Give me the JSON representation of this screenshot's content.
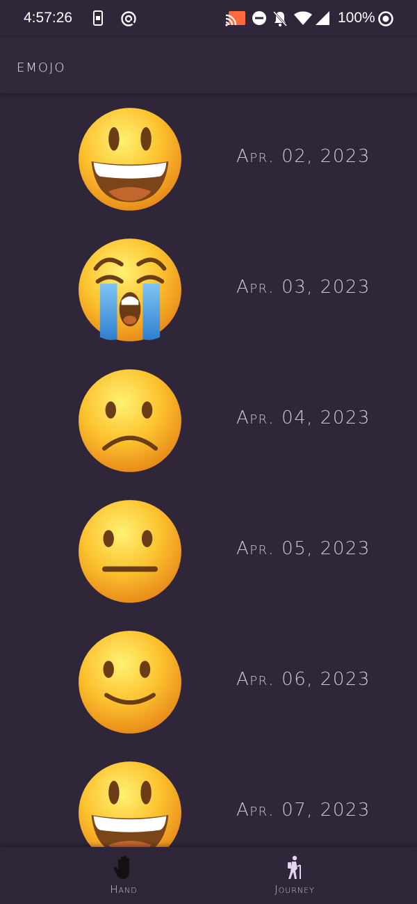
{
  "status_bar": {
    "time": "4:57:26",
    "battery": "100%",
    "icons": [
      "sim-card-icon",
      "at-sign-icon",
      "cast-icon",
      "do-not-disturb-icon",
      "bell-off-icon",
      "wifi-icon",
      "signal-icon",
      "battery-ring-icon"
    ]
  },
  "app_bar": {
    "title": "emojo"
  },
  "entries": [
    {
      "emoji": "grinning-face",
      "date": "Apr. 02, 2023"
    },
    {
      "emoji": "loudly-crying-face",
      "date": "Apr. 03, 2023"
    },
    {
      "emoji": "frowning-face",
      "date": "Apr. 04, 2023"
    },
    {
      "emoji": "neutral-face",
      "date": "Apr. 05, 2023"
    },
    {
      "emoji": "slightly-smiling-face",
      "date": "Apr. 06, 2023"
    },
    {
      "emoji": "grinning-face",
      "date": "Apr. 07, 2023"
    }
  ],
  "bottom_nav": {
    "items": [
      {
        "label": "Hand",
        "icon": "hand-icon",
        "active": true
      },
      {
        "label": "Journey",
        "icon": "hiker-icon",
        "active": false
      }
    ]
  },
  "colors": {
    "background": "#30263a",
    "app_bar": "#31283a",
    "text": "#cfc8d6"
  }
}
